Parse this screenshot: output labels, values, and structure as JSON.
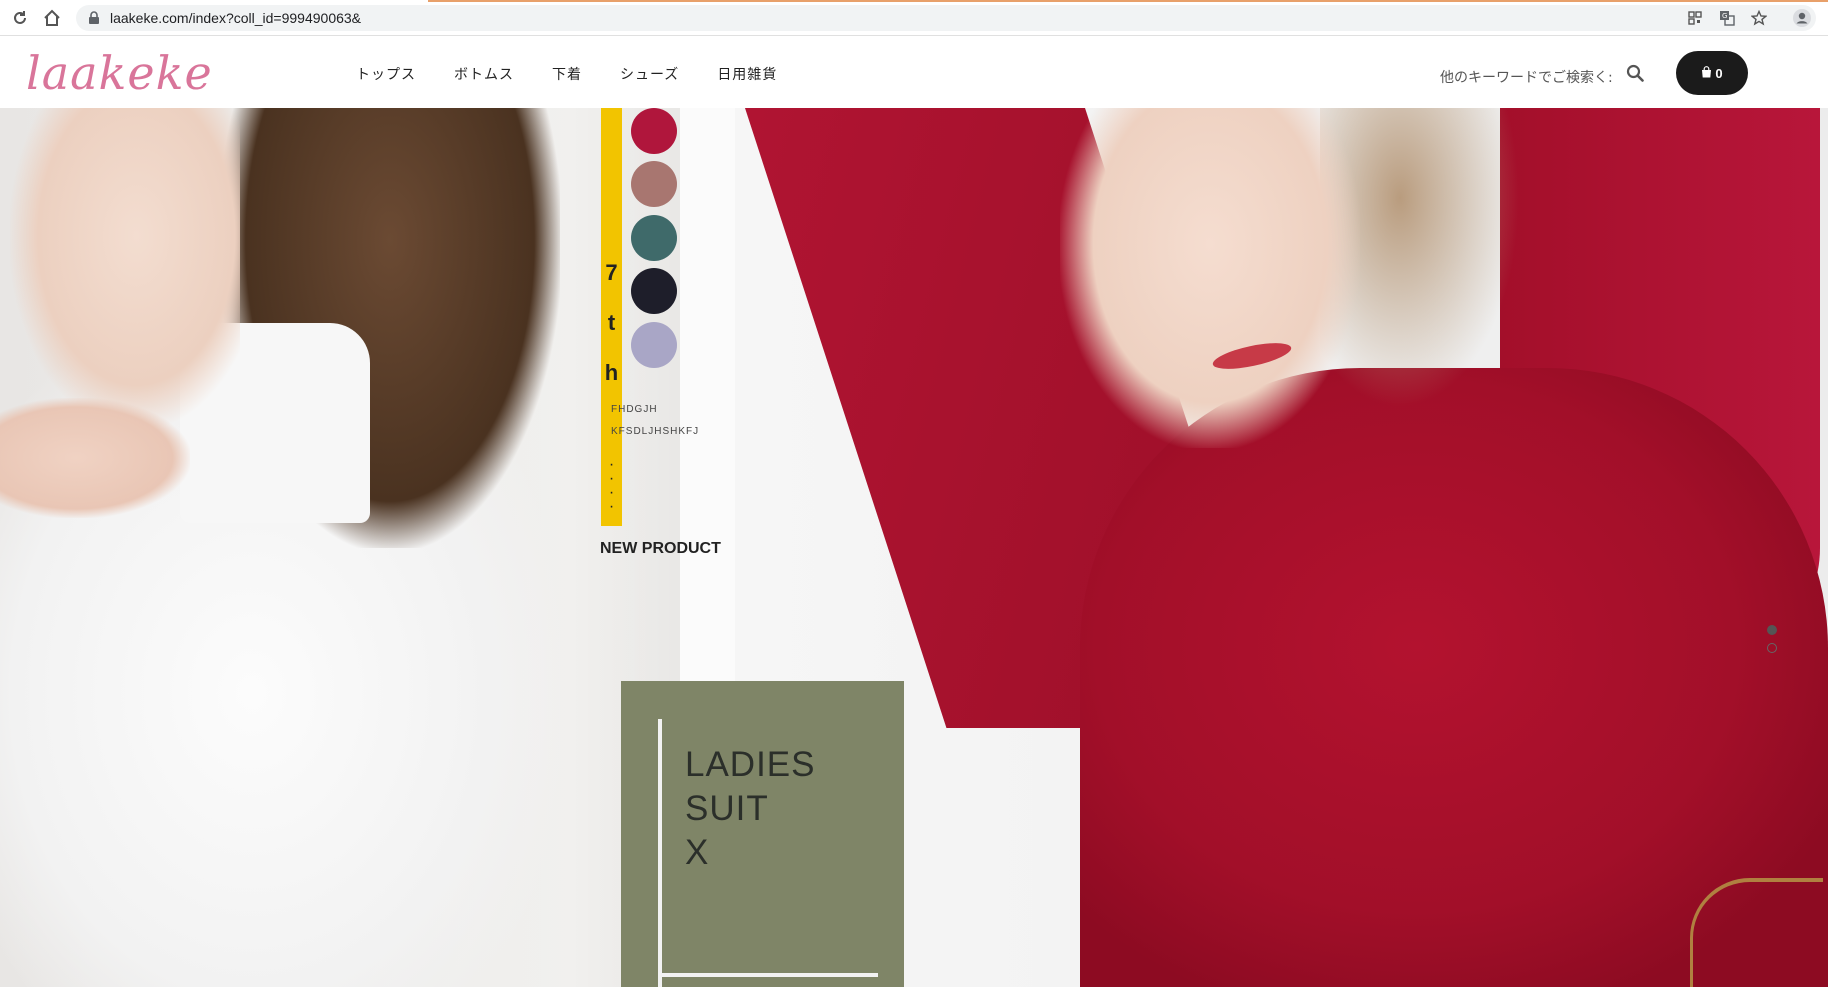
{
  "browser": {
    "url": "laakeke.com/index?coll_id=999490063&",
    "icons": [
      "reload-icon",
      "home-icon",
      "lock-icon",
      "qr-icon",
      "translate-icon",
      "star-icon",
      "profile-icon"
    ]
  },
  "header": {
    "logo": "laakeke",
    "nav": [
      {
        "label": "トップス"
      },
      {
        "label": "ボトムス"
      },
      {
        "label": "下着"
      },
      {
        "label": "シューズ"
      },
      {
        "label": "日用雑貨"
      }
    ],
    "search_placeholder": "他のキーワードでご検索く:",
    "cart_count": "0"
  },
  "hero": {
    "vertical_text": [
      "7",
      "t",
      "h"
    ],
    "small_text_1": "FHDGJH",
    "small_text_2": "KFSDLJHSHKFJ",
    "new_product": "NEW PRODUCT",
    "box_lines": [
      "LADIES",
      "SUIT",
      "X"
    ],
    "swatch_colors": [
      "#b0163c",
      "#a87670",
      "#3f6a6a",
      "#1e1e2a",
      "#a9a6c6"
    ],
    "slides_total": 2,
    "active_slide": 1
  },
  "colors": {
    "logo": "#d9759a",
    "cart": "#1b1b1b",
    "yellow": "#f2c400",
    "olive": "#7f8567",
    "red": "#a20f29"
  }
}
